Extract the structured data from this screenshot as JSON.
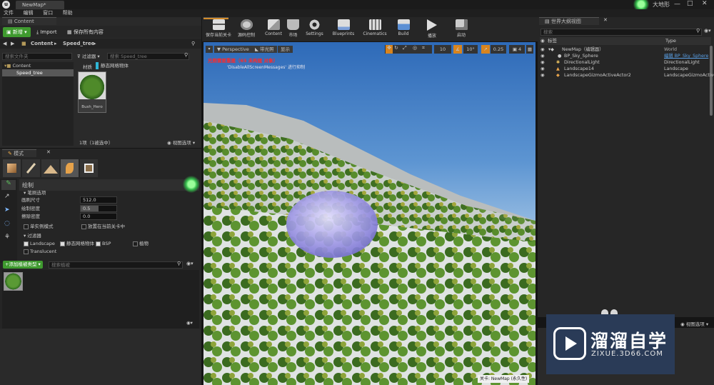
{
  "window": {
    "tab_title": "NewMap*",
    "corner_label": "大地形"
  },
  "menu": [
    "文件",
    "编辑",
    "窗口",
    "帮助"
  ],
  "content_browser": {
    "tab": "Content Browser",
    "add_new": "新增",
    "import": "Import",
    "save_all": "保存所有内容",
    "path": [
      "Content",
      "Speed_tree"
    ],
    "folder_search_placeholder": "搜索文件夹",
    "tree": [
      "Content",
      "Speed_tree"
    ],
    "filters_label": "过滤器",
    "asset_search_placeholder": "搜索 Speed_tree",
    "filter_chips": [
      "材质",
      "静态网格物体"
    ],
    "assets": [
      {
        "name": "Bush_Hero"
      }
    ],
    "status": "1项（1被选中）",
    "view_options": "视图选项"
  },
  "modes": {
    "tab": "模式",
    "section_title": "绘制",
    "brush_section": "笔刷选项",
    "props": [
      {
        "label": "画刷尺寸",
        "value": "512.0"
      },
      {
        "label": "绘制密度",
        "value": "0.5"
      },
      {
        "label": "擦除密度",
        "value": "0.0"
      }
    ],
    "single_instance": "单实例模式",
    "place_current_level": "放置在当前关卡中",
    "filter_section": "过滤器",
    "filters": [
      {
        "label": "Landscape",
        "checked": true
      },
      {
        "label": "静态网格物体",
        "checked": true
      },
      {
        "label": "BSP",
        "checked": true
      },
      {
        "label": "植物",
        "checked": false
      },
      {
        "label": "Translucent",
        "checked": false
      }
    ],
    "add_foliage_type": "+添加植被类型",
    "foliage_search_placeholder": "搜索植被"
  },
  "toolbar": [
    {
      "label": "保存当前关卡",
      "icon": "save-icon"
    },
    {
      "label": "源码控制",
      "icon": "source-control-icon"
    },
    {
      "label": "Content",
      "icon": "content-icon"
    },
    {
      "label": "市场",
      "icon": "marketplace-icon"
    },
    {
      "label": "Settings",
      "icon": "settings-icon"
    },
    {
      "label": "Blueprints",
      "icon": "blueprints-icon"
    },
    {
      "label": "Cinematics",
      "icon": "cinematics-icon"
    },
    {
      "label": "Build",
      "icon": "build-icon"
    },
    {
      "label": "播放",
      "icon": "play-icon"
    },
    {
      "label": "启动",
      "icon": "launch-icon"
    }
  ],
  "viewport": {
    "perspective": "Perspective",
    "lit": "带光照",
    "show": "显示",
    "warning": "光照需要重建（65 未构建 对象）",
    "warning_sub": "'DisableAllScreenMessages' 进行抑制",
    "grid": "10",
    "rotation": "10°",
    "scale": "0.25",
    "camera_speed": "4",
    "level_label": "关卡: NewMap (永久性)"
  },
  "outliner": {
    "tab": "世界大纲视图",
    "search_placeholder": "搜索",
    "col_label": "标签",
    "col_type": "Type",
    "rows": [
      {
        "label": "NewMap（编辑器）",
        "type": "World"
      },
      {
        "label": "BP_Sky_Sphere",
        "type": "编辑 BP_Sky_Sphere"
      },
      {
        "label": "DirectionalLight",
        "type": "DirectionalLight"
      },
      {
        "label": "Landscape14",
        "type": "Landscape"
      },
      {
        "label": "LandscapeGizmoActiveActor2",
        "type": "LandscapeGizmoActive"
      }
    ],
    "view_options": "视图选项"
  },
  "watermark": {
    "title": "溜溜自学",
    "url": "ZIXUE.3D66.COM"
  },
  "colors": {
    "accent_green": "#3f9a2f",
    "panel": "#2a2a2a",
    "link_blue": "#5aa0e6",
    "warning_red": "#ff2a2a",
    "watermark_bg": "#2a3b57"
  }
}
